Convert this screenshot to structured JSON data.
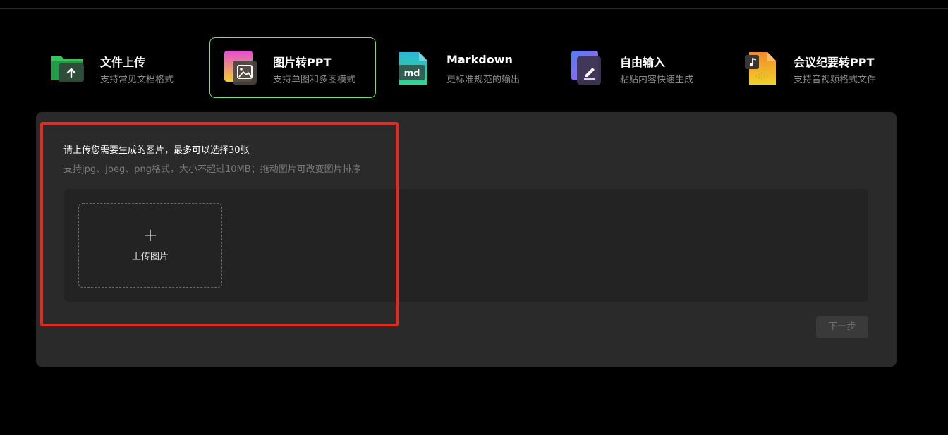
{
  "modes": [
    {
      "title": "文件上传",
      "desc": "支持常见文档格式",
      "icon": "folder-upload-icon",
      "color": "#2fbf5a",
      "active": false
    },
    {
      "title": "图片转PPT",
      "desc": "支持单图和多图模式",
      "icon": "image-icon",
      "color": "#e35bd2",
      "active": true
    },
    {
      "title": "Markdown",
      "desc": "更标准规范的输出",
      "icon": "markdown-file-icon",
      "color": "#2cc3b8",
      "active": false
    },
    {
      "title": "自由输入",
      "desc": "粘贴内容快速生成",
      "icon": "edit-icon",
      "color": "#8a6cf2",
      "active": false
    },
    {
      "title": "会议纪要转PPT",
      "desc": "支持音视频格式文件",
      "icon": "audio-file-icon",
      "color": "#f0b72a",
      "active": false
    }
  ],
  "panel": {
    "title": "请上传您需要生成的图片，最多可以选择30张",
    "hint": "支持jpg、jpeg、png格式，大小不超过10MB；拖动图片可改变图片排序",
    "upload_plus": "+",
    "upload_label": "上传图片",
    "next_label": "下一步"
  },
  "colors": {
    "background": "#000000",
    "panel": "#2a2a2a",
    "active_border": "#6ee06e",
    "highlight": "#e8271e"
  }
}
